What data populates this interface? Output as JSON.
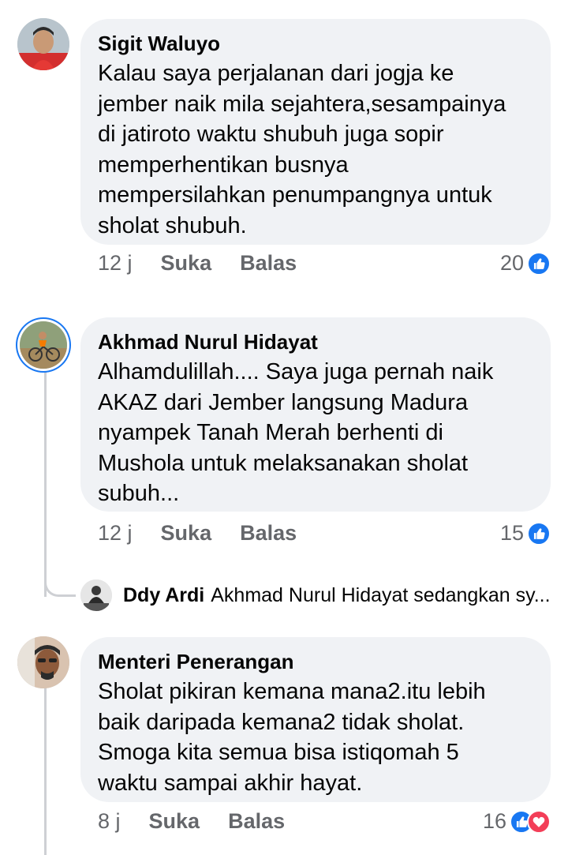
{
  "comments": [
    {
      "author": "Sigit Waluyo",
      "text": "Kalau saya perjalanan dari jogja ke\njember naik mila sejahtera,sesampainya\ndi jatiroto waktu shubuh juga sopir\nmemperhentikan busnya\nmempersilahkan penumpangnya untuk\nsholat shubuh.",
      "time": "12 j",
      "like_label": "Suka",
      "reply_label": "Balas",
      "reaction_count": "20",
      "reactions": [
        "like-icon"
      ]
    },
    {
      "author": "Akhmad Nurul Hidayat",
      "text": "Alhamdulillah.... Saya juga pernah naik\nAKAZ dari Jember langsung Madura\nnyampek Tanah Merah berhenti di\nMushola untuk melaksanakan sholat\nsubuh...",
      "time": "12 j",
      "like_label": "Suka",
      "reply_label": "Balas",
      "reaction_count": "15",
      "reactions": [
        "like-icon"
      ],
      "reply_preview": {
        "author": "Ddy Ardi",
        "text": "Akhmad Nurul Hidayat sedangkan sy..."
      }
    },
    {
      "author": "Menteri Penerangan",
      "text": "Sholat pikiran kemana mana2.itu lebih\nbaik daripada kemana2 tidak sholat.\nSmoga kita semua bisa istiqomah 5\nwaktu sampai akhir hayat.",
      "time": "8 j",
      "like_label": "Suka",
      "reply_label": "Balas",
      "reaction_count": "16",
      "reactions": [
        "like-icon",
        "love-icon"
      ]
    }
  ],
  "colors": {
    "bubble": "#f0f2f5",
    "meta_text": "#65676b",
    "like": "#1877f2",
    "love": "#f33e58",
    "thread_line": "#ced0d4"
  }
}
